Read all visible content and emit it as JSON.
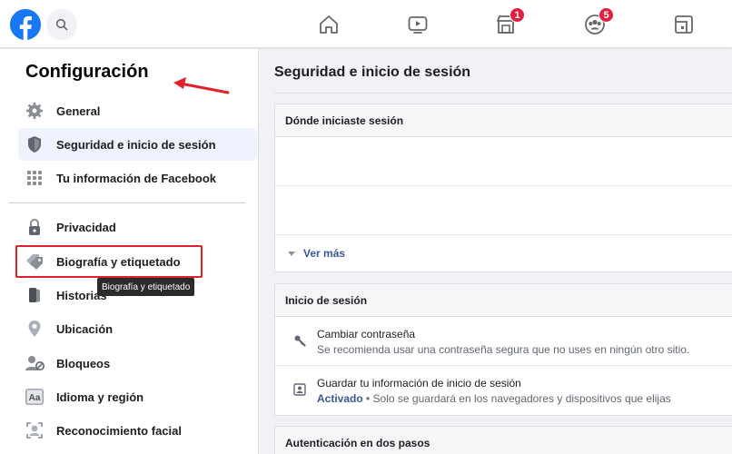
{
  "topbar": {
    "marketplace_badge": "1",
    "groups_badge": "5"
  },
  "sidebar": {
    "title": "Configuración",
    "items": [
      {
        "label": "General",
        "icon": "gear-icon"
      },
      {
        "label": "Seguridad e inicio de sesión",
        "icon": "shield-icon"
      },
      {
        "label": "Tu información de Facebook",
        "icon": "grid-icon"
      },
      {
        "label": "Privacidad",
        "icon": "lock-icon"
      },
      {
        "label": "Biografía y etiquetado",
        "icon": "tag-icon"
      },
      {
        "label": "Historias",
        "icon": "book-icon"
      },
      {
        "label": "Ubicación",
        "icon": "location-pin-icon"
      },
      {
        "label": "Bloqueos",
        "icon": "block-user-icon"
      },
      {
        "label": "Idioma y región",
        "icon": "language-icon"
      },
      {
        "label": "Reconocimiento facial",
        "icon": "face-icon"
      }
    ],
    "tooltip": "Biografía y etiquetado"
  },
  "main": {
    "title": "Seguridad e inicio de sesión",
    "where_logged_in": {
      "header": "Dónde iniciaste sesión",
      "see_more": "Ver más"
    },
    "login": {
      "header": "Inicio de sesión",
      "change_password": {
        "title": "Cambiar contraseña",
        "desc": "Se recomienda usar una contraseña segura que no uses en ningún otro sitio."
      },
      "save_login": {
        "title": "Guardar tu información de inicio de sesión",
        "status": "Activado",
        "desc": " • Solo se guardará en los navegadores y dispositivos que elijas"
      }
    },
    "two_factor": {
      "header": "Autenticación en dos pasos"
    }
  },
  "colors": {
    "brand": "#1877f2",
    "link": "#385898",
    "badge": "#e41e3f",
    "highlight": "#e0202a"
  }
}
